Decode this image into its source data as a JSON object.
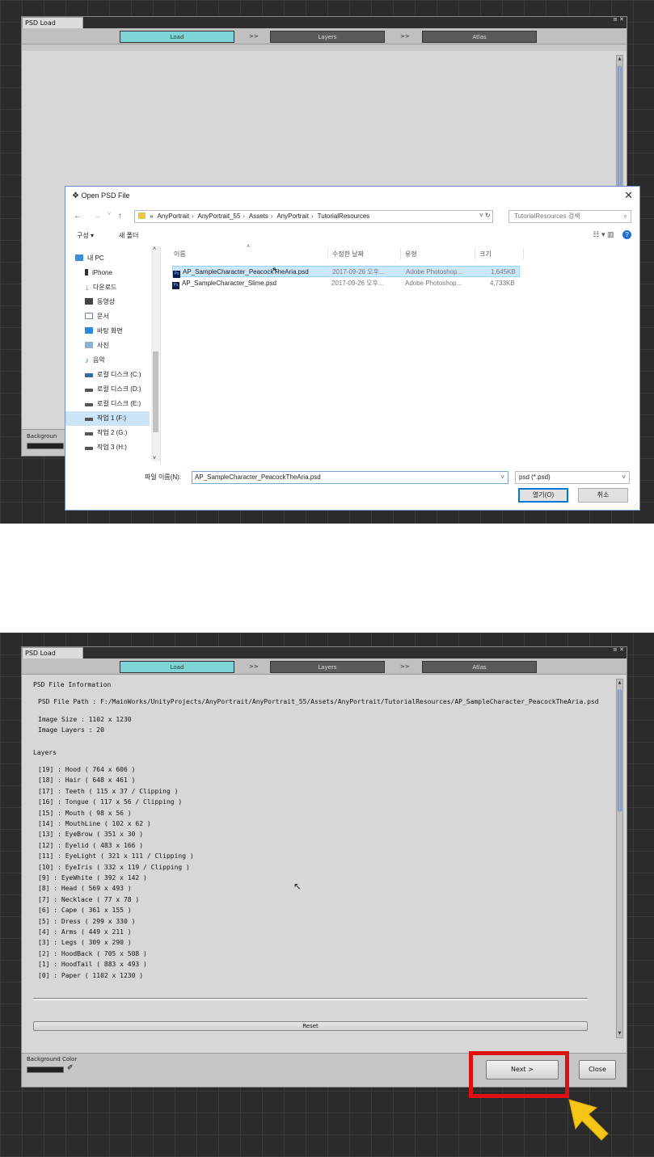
{
  "window": {
    "tab_title": "PSD Load",
    "corner": "≡ ✕",
    "steps": [
      "Load",
      "Layers",
      "Atlas"
    ],
    "arrow": ">>",
    "bg_color_label_full": "Background Color",
    "bg_color_label_cut": "Backgroun",
    "scroll_up": "▲",
    "scroll_down": "▼",
    "colors": {
      "active_step": "#7fd4d8",
      "inactive_step": "#5a5a5a",
      "panel": "#d7d7d7"
    }
  },
  "dialog": {
    "title": "Open PSD File",
    "close": "✕",
    "nav": {
      "back": "←",
      "forward": "→",
      "recent": "˅",
      "up": "↑"
    },
    "breadcrumb": [
      "«",
      "AnyPortrait",
      "AnyPortrait_55",
      "Assets",
      "AnyPortrait",
      "TutorialResources"
    ],
    "breadcrumb_sep": "›",
    "refresh": "˅  ↻",
    "search_placeholder": "TutorialResources 검색",
    "search_icon": "⌕",
    "organize": "구성 ▾",
    "new_folder": "새 폴더",
    "view_icons": "☷ ▾    ▥",
    "help": "?",
    "sidebar": [
      {
        "label": "내 PC",
        "icon": "pc-icon",
        "color": "#3a8fd9"
      },
      {
        "label": "iPhone",
        "icon": "phone-icon",
        "color": "#333333"
      },
      {
        "label": "다운로드",
        "icon": "download-icon",
        "color": "#2a7dd1"
      },
      {
        "label": "동영상",
        "icon": "video-icon",
        "color": "#444444"
      },
      {
        "label": "문서",
        "icon": "document-icon",
        "color": "#6a8ab0"
      },
      {
        "label": "바탕 화면",
        "icon": "desktop-icon",
        "color": "#2a8ae0"
      },
      {
        "label": "사진",
        "icon": "picture-icon",
        "color": "#5a8ab0"
      },
      {
        "label": "음악",
        "icon": "music-icon",
        "color": "#2a7dd1"
      },
      {
        "label": "로컬 디스크 (C:)",
        "icon": "drive-icon",
        "color": "#3a6aa0"
      },
      {
        "label": "로컬 디스크 (D:)",
        "icon": "drive-icon",
        "color": "#555555"
      },
      {
        "label": "로컬 디스크 (E:)",
        "icon": "drive-icon",
        "color": "#555555"
      },
      {
        "label": "작업 1 (F:)",
        "icon": "drive-icon",
        "color": "#555555"
      },
      {
        "label": "작업 2 (G:)",
        "icon": "drive-icon",
        "color": "#555555"
      },
      {
        "label": "작업 3 (H:)",
        "icon": "drive-icon",
        "color": "#555555"
      }
    ],
    "tree_scroll": {
      "up": "˄",
      "down": "˅"
    },
    "columns": [
      "이름",
      "수정한 날짜",
      "유형",
      "크기"
    ],
    "sort_arrow": "˄",
    "files": [
      {
        "icon": "Ps",
        "name": "AP_SampleCharacter_PeacockTheAria.psd",
        "date": "2017-09-26 오후...",
        "type": "Adobe Photoshop...",
        "size": "1,645KB"
      },
      {
        "icon": "Ps",
        "name": "AP_SampleCharacter_Slime.psd",
        "date": "2017-09-26 오후...",
        "type": "Adobe Photoshop...",
        "size": "4,733KB"
      }
    ],
    "filename_label": "파일 이름(N):",
    "filename_value": "AP_SampleCharacter_PeacockTheAria.psd",
    "filetype": "psd (*.psd)",
    "dropdown": "˅",
    "open_button": "열기(O)",
    "cancel_button": "취소",
    "resize_grip": "⋰"
  },
  "info": {
    "heading": "PSD File Information",
    "path_label": "PSD File Path : F:/MainWorks/UnityProjects/AnyPortrait/AnyPortrait_55/Assets/AnyPortrait/TutorialResources/AP_SampleCharacter_PeacockTheAria.psd",
    "image_size": "Image Size : 1102 x 1230",
    "image_layers": "Image Layers : 20",
    "layers_heading": "Layers",
    "layers": [
      "[19] : Hood  ( 764 x 606 )",
      "[18] : Hair  ( 648 x 461 )",
      "[17] : Teeth  ( 115 x 37 / Clipping )",
      "[16] : Tongue  ( 117 x 56 / Clipping )",
      "[15] : Mouth  ( 98 x 56 )",
      "[14] : MouthLine  ( 102 x 62 )",
      "[13] : EyeBrow  ( 351 x 30 )",
      "[12] : Eyelid  ( 483 x 166 )",
      "[11] : EyeLight  ( 321 x 111 / Clipping )",
      "[10] : EyeIris  ( 332 x 119 / Clipping )",
      "[9] : EyeWhite  ( 392 x 142 )",
      "[8] : Head  ( 569 x 493 )",
      "[7] : Necklace  ( 77 x 78 )",
      "[6] : Cape  ( 361 x 155 )",
      "[5] : Dress  ( 299 x 330 )",
      "[4] : Arms  ( 449 x 211 )",
      "[3] : Legs  ( 309 x 290 )",
      "[2] : HoodBack  ( 705 x 508 )",
      "[1] : HoodTail  ( 883 x 493 )",
      "[0] : Paper  ( 1102 x 1230 )"
    ],
    "reset_button": "Reset",
    "next_button": "Next >",
    "close_button": "Close",
    "eyedropper": "✐"
  },
  "highlight_color": "#e01010",
  "pointer_color": "#f5c518"
}
